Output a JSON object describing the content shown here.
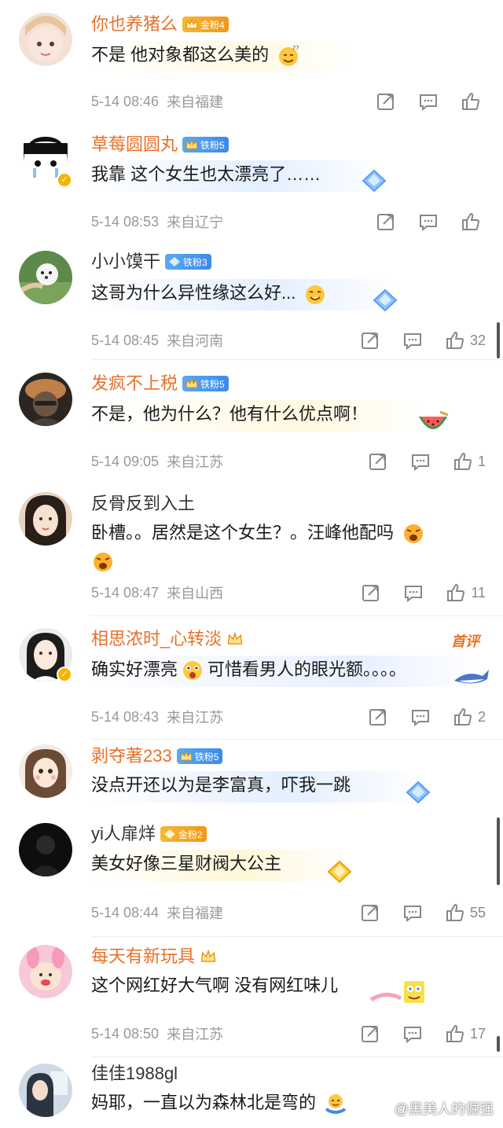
{
  "comments": [
    {
      "name": "你也养猪么",
      "badge": "金粉4",
      "text": "不是 他对象都这么美的",
      "time": "5-14 08:46",
      "loc": "来自福建",
      "likes": ""
    },
    {
      "name": "草莓圆圆丸",
      "badge": "铁粉5",
      "text": "我靠 这个女生也太漂亮了……",
      "time": "5-14 08:53",
      "loc": "来自辽宁",
      "likes": ""
    },
    {
      "name": "小小馍干",
      "badge": "铁粉3",
      "text": "这哥为什么异性缘这么好...",
      "time": "5-14 08:45",
      "loc": "来自河南",
      "likes": "32"
    },
    {
      "name": "发疯不上税",
      "badge": "铁粉5",
      "text": "不是，他为什么？他有什么优点啊！",
      "time": "5-14 09:05",
      "loc": "来自江苏",
      "likes": "1"
    },
    {
      "name": "反骨反到入土",
      "badge": "",
      "text": "卧槽。。居然是这个女生？。汪峰他配吗",
      "time": "5-14 08:47",
      "loc": "来自山西",
      "likes": "11"
    },
    {
      "name": "相思浓时_心转淡",
      "badge": "",
      "text_a": "确实好漂亮",
      "text_b": "可惜看男人的眼光额。。。。",
      "first": "首评",
      "time": "5-14 08:43",
      "loc": "来自江苏",
      "likes": "2"
    },
    {
      "name": "剥夺著233",
      "badge": "铁粉5",
      "text": "没点开还以为是李富真，吓我一跳",
      "time": "",
      "loc": "",
      "likes": ""
    },
    {
      "name": "yi人扉烊",
      "badge": "金粉2",
      "text": "美女好像三星财阀大公主",
      "time": "5-14 08:44",
      "loc": "来自福建",
      "likes": "55"
    },
    {
      "name": "每天有新玩具",
      "badge": "",
      "text": "这个网红好大气啊  没有网红味儿",
      "time": "5-14 08:50",
      "loc": "来自江苏",
      "likes": "17"
    },
    {
      "name": "佳佳1988gl",
      "badge": "",
      "text": "妈耶，一直以为森林北是弯的",
      "time": "",
      "loc": "",
      "likes": ""
    }
  ],
  "watermark": "@黑美人的倔强",
  "colors": {
    "orange_name": "#e8702a",
    "meta_gray": "#999999",
    "gold_badge": "#f09819",
    "iron_badge": "#3d8ae8"
  }
}
